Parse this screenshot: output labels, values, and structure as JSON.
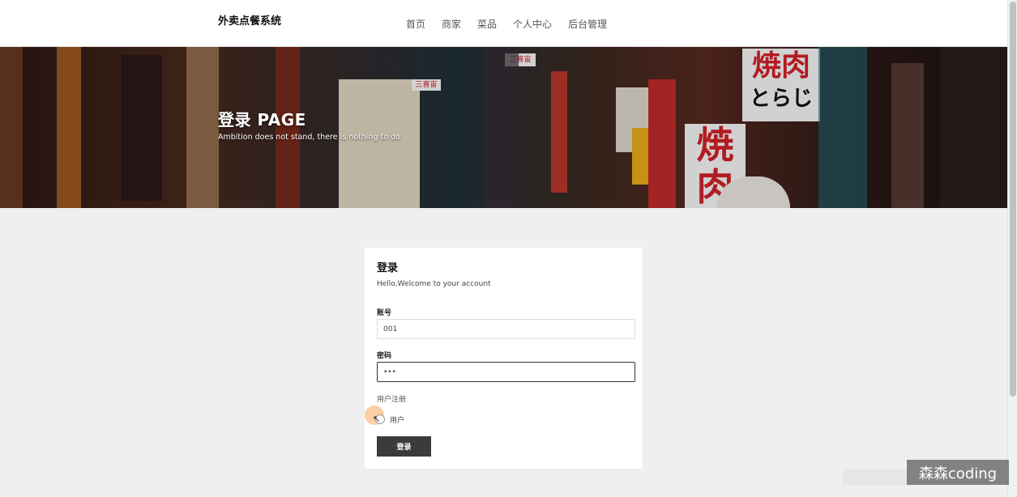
{
  "header": {
    "brand": "外卖点餐系统",
    "nav": [
      "首页",
      "商家",
      "菜品",
      "个人中心",
      "后台管理"
    ]
  },
  "hero": {
    "title": "登录 PAGE",
    "subtitle": "Ambition does not stand, there is nothing to do",
    "signs": [
      "焼肉",
      "とらじ",
      "焼",
      "肉",
      "三喜宙",
      "三喜宙"
    ]
  },
  "login": {
    "title": "登录",
    "welcome": "Hello,Welcome to your account",
    "account_label": "账号",
    "account_value": "001",
    "password_label": "密码",
    "password_value": "•••",
    "register_link": "用户注册",
    "role_label": "用户",
    "submit_label": "登录"
  },
  "watermark": "森森coding",
  "colors": {
    "page_bg": "#efeef1",
    "button_bg": "#3b3b3d",
    "sign_red": "#d8232a"
  }
}
